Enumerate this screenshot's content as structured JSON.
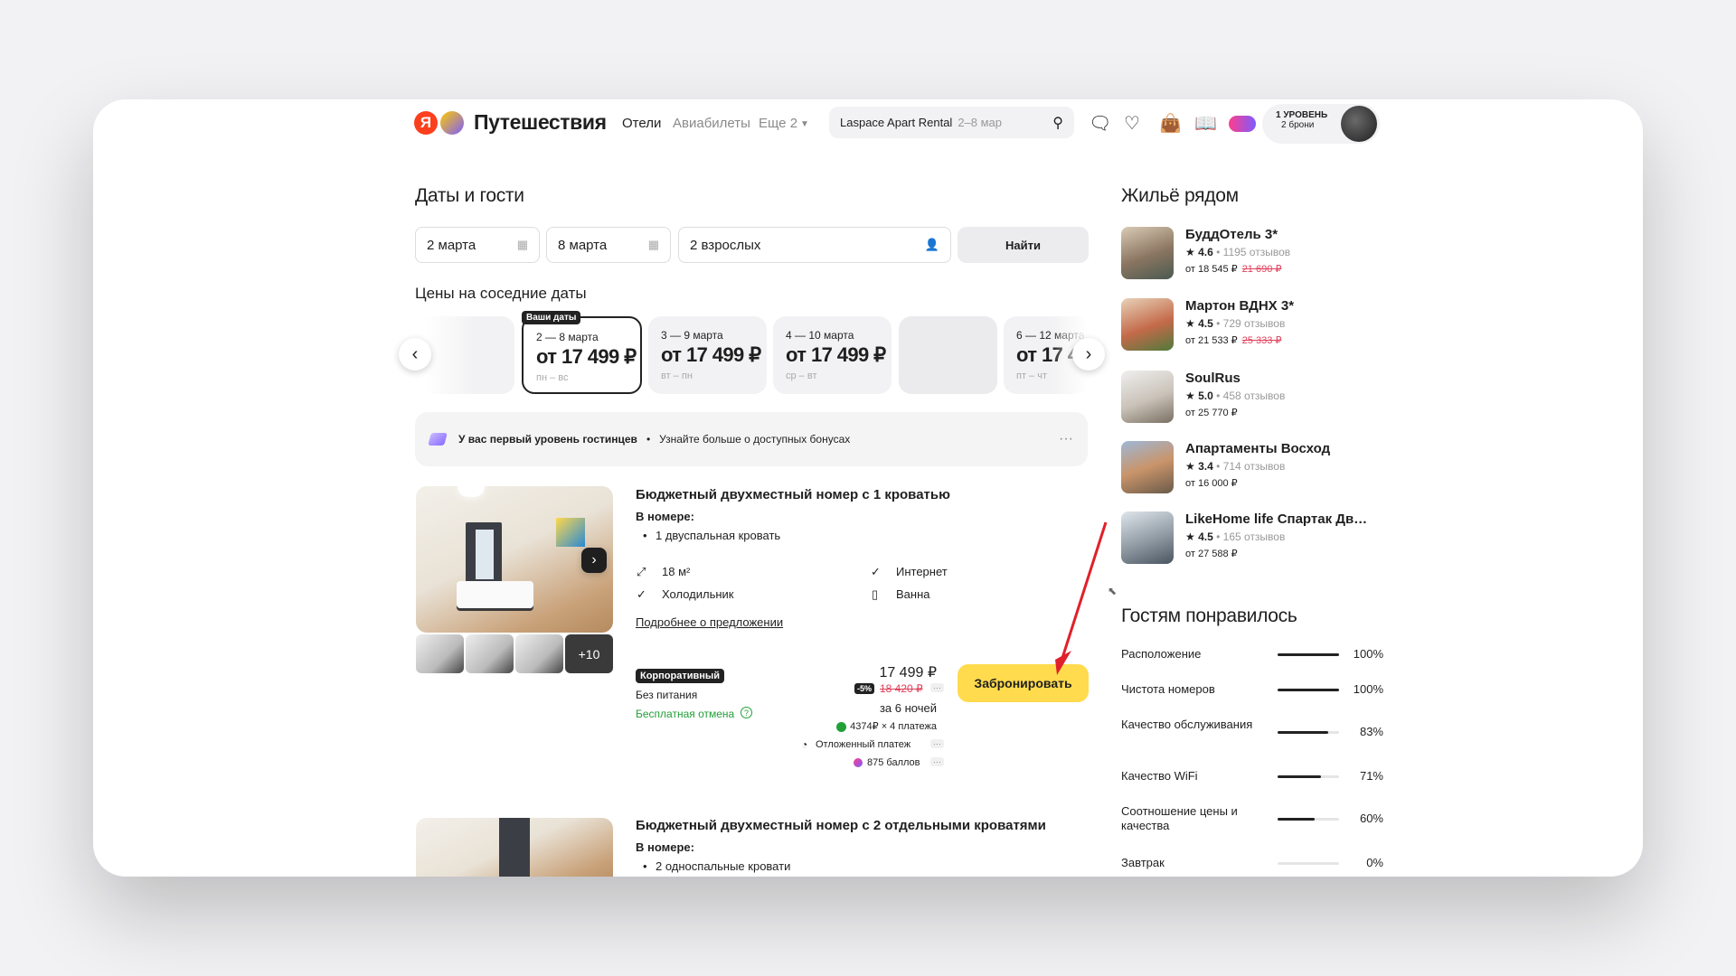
{
  "header": {
    "logo_letter": "Я",
    "brand": "Путешествия",
    "nav": [
      "Отели",
      "Авиабилеты",
      "Еще 2"
    ],
    "search_text": "Laspace Apart Rental",
    "search_dates": "2–8 мар",
    "level_title": "1 УРОВЕНЬ",
    "level_sub": "2 брони"
  },
  "dates_section": {
    "title": "Даты и гости",
    "checkin": "2 марта",
    "checkout": "8 марта",
    "guests": "2 взрослых",
    "find_label": "Найти"
  },
  "neighbor_dates": {
    "title": "Цены на соседние даты",
    "badge": "Ваши даты",
    "cards": [
      {
        "range": "2 — 8 марта",
        "price": "от 17 499 ₽",
        "days": "пн – вс",
        "selected": true
      },
      {
        "range": "3 — 9 марта",
        "price": "от 17 499 ₽",
        "days": "вт – пн"
      },
      {
        "range": "4 — 10 марта",
        "price": "от 17 499 ₽",
        "days": "ср – вт"
      },
      {
        "range": "6 — 12 марта",
        "price": "от 17 4",
        "days": "пт – чт"
      }
    ]
  },
  "banner": {
    "level_text": "У вас первый уровень гостинцев",
    "more_text": "Узнайте больше о доступных бонусах"
  },
  "room1": {
    "title": "Бюджетный двухместный номер с 1 кроватью",
    "in_room_label": "В номере:",
    "bed": "1 двуспальная кровать",
    "area": "18 м²",
    "fridge": "Холодильник",
    "internet": "Интернет",
    "bath": "Ванна",
    "more_link": "Подробнее о предложении",
    "thumb_more": "+10",
    "tariff": "Корпоративный",
    "meal": "Без питания",
    "cancel": "Бесплатная отмена",
    "price": "17 499 ₽",
    "discount": "-5%",
    "old_price": "18 420 ₽",
    "nights": "за 6 ночей",
    "split": "4374₽ × 4 платежа",
    "deferred": "Отложенный платеж",
    "points": "875 баллов",
    "book_label": "Забронировать"
  },
  "room2": {
    "title": "Бюджетный двухместный номер с 2 отдельными кроватями",
    "in_room_label": "В номере:",
    "beds": "2 односпальные кровати"
  },
  "nearby": {
    "title": "Жильё рядом",
    "hotels": [
      {
        "name": "БуддОтель 3*",
        "rating": "4.6",
        "reviews": "1195 отзывов",
        "price": "от 18 545 ₽",
        "old": "21 690 ₽"
      },
      {
        "name": "Мартон ВДНХ 3*",
        "rating": "4.5",
        "reviews": "729 отзывов",
        "price": "от 21 533 ₽",
        "old": "25 333 ₽"
      },
      {
        "name": "SoulRus",
        "rating": "5.0",
        "reviews": "458 отзывов",
        "price": "от 25 770 ₽"
      },
      {
        "name": "Апартаменты Восход",
        "rating": "3.4",
        "reviews": "714 отзывов",
        "price": "от 16 000 ₽"
      },
      {
        "name": "LikeHome life Спартак Дв…",
        "rating": "4.5",
        "reviews": "165 отзывов",
        "price": "от 27 588 ₽"
      }
    ]
  },
  "liked": {
    "title": "Гостям понравилось",
    "metrics": [
      {
        "label": "Расположение",
        "value": "100%",
        "pct": 100
      },
      {
        "label": "Чистота номеров",
        "value": "100%",
        "pct": 100
      },
      {
        "label": "Качество обслуживания",
        "value": "83%",
        "pct": 83
      },
      {
        "label": "Качество WiFi",
        "value": "71%",
        "pct": 71
      },
      {
        "label": "Соотношение цены и качества",
        "value": "60%",
        "pct": 60
      },
      {
        "label": "Завтрак",
        "value": "0%",
        "pct": 0
      }
    ]
  },
  "colors": {
    "accent_yellow": "#ffdb4d",
    "discount_red": "#e0405a",
    "cancel_green": "#21a038",
    "annotation_arrow": "#e0202a"
  }
}
